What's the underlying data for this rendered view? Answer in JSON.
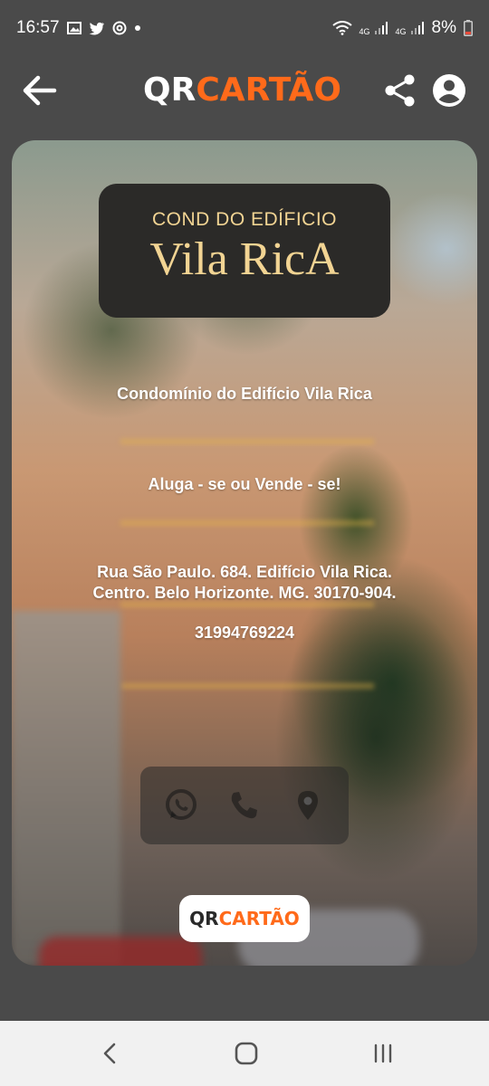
{
  "status_bar": {
    "time": "16:57",
    "battery_percent": "8%",
    "network_label_1": "4G",
    "network_label_2": "4G",
    "icons": [
      "gallery-icon",
      "twitter-icon",
      "at-sign-icon",
      "notification-dot-icon",
      "wifi-icon",
      "signal-icon",
      "signal-icon",
      "battery-icon"
    ]
  },
  "header": {
    "logo_qr": "QR",
    "logo_cartao": "CARTÃO",
    "back_icon": "arrow-left-icon",
    "share_icon": "share-icon",
    "account_icon": "account-circle-icon"
  },
  "card": {
    "brand_top": "COND DO EDÍFICIO",
    "brand_name": "Vila RicA",
    "title": "Condomínio do Edifício Vila Rica",
    "tagline": "Aluga - se ou Vende - se!",
    "address_line1": "Rua São Paulo. 684. Edifício Vila Rica.",
    "address_line2": "Centro. Belo Horizonte. MG. 30170-904.",
    "phone": "31994769224",
    "actions": [
      "whatsapp-icon",
      "phone-icon",
      "location-pin-icon"
    ],
    "badge_qr": "QR",
    "badge_cartao": "CARTÃO"
  },
  "colors": {
    "accent": "#ff6a1a",
    "background": "#4a4a4a",
    "brand_gold": "#f2d493",
    "brand_box": "#2b2a28"
  },
  "nav_bar": {
    "icons": [
      "nav-back-icon",
      "nav-home-icon",
      "nav-recents-icon"
    ]
  }
}
